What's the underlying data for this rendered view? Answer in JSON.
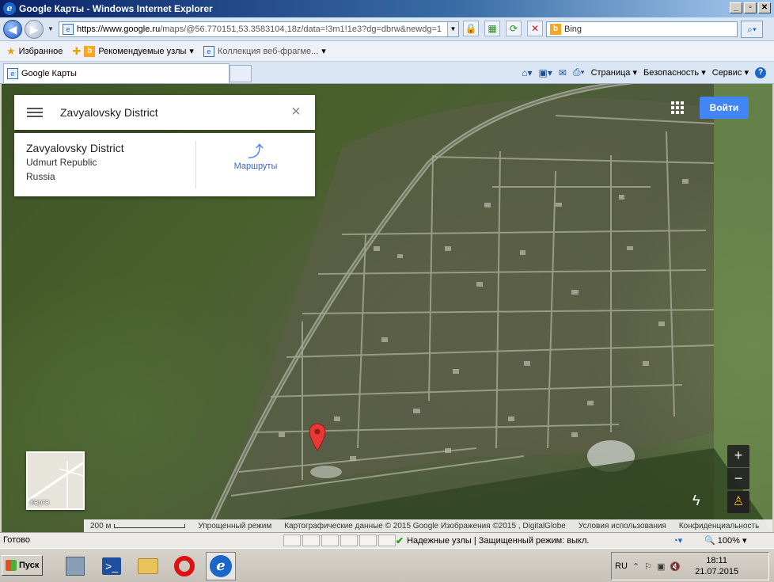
{
  "window": {
    "title": "Google Карты - Windows Internet Explorer",
    "controls": [
      "_",
      "2",
      "X"
    ]
  },
  "address": {
    "scheme": "https://",
    "host": "www.google.ru",
    "path": "/maps/@56.770151,53.3583104,18z/data=!3m1!1e3?dg=dbrw&newdg=1",
    "search_placeholder": "Bing"
  },
  "favorites": {
    "favorites_label": "Избранное",
    "suggested_sites": "Рекомендуемые узлы",
    "web_slices": "Коллекция веб-фрагме..."
  },
  "tab": {
    "title": "Google Карты"
  },
  "command_bar": {
    "page": "Страница",
    "safety": "Безопасность",
    "tools": "Сервис"
  },
  "map": {
    "search_query": "Zavyalovsky District",
    "place": {
      "name": "Zavyalovsky District",
      "region": "Udmurt Republic",
      "country": "Russia"
    },
    "directions_label": "Маршруты",
    "sign_in_label": "Войти",
    "minimap_label": "Карта",
    "zoom_in": "+",
    "zoom_out": "−",
    "footer": {
      "scale": "200 м",
      "lite_mode": "Упрощенный режим",
      "attribution": "Картографические данные © 2015 Google Изображения ©2015 , DigitalGlobe",
      "terms": "Условия использования",
      "privacy": "Конфиденциальность"
    }
  },
  "status": {
    "ready": "Готово",
    "zone": "Надежные узлы | Защищенный режим: выкл.",
    "zoom": "100%"
  },
  "taskbar": {
    "start": "Пуск",
    "lang": "RU",
    "time": "18:11",
    "date": "21.07.2015"
  }
}
